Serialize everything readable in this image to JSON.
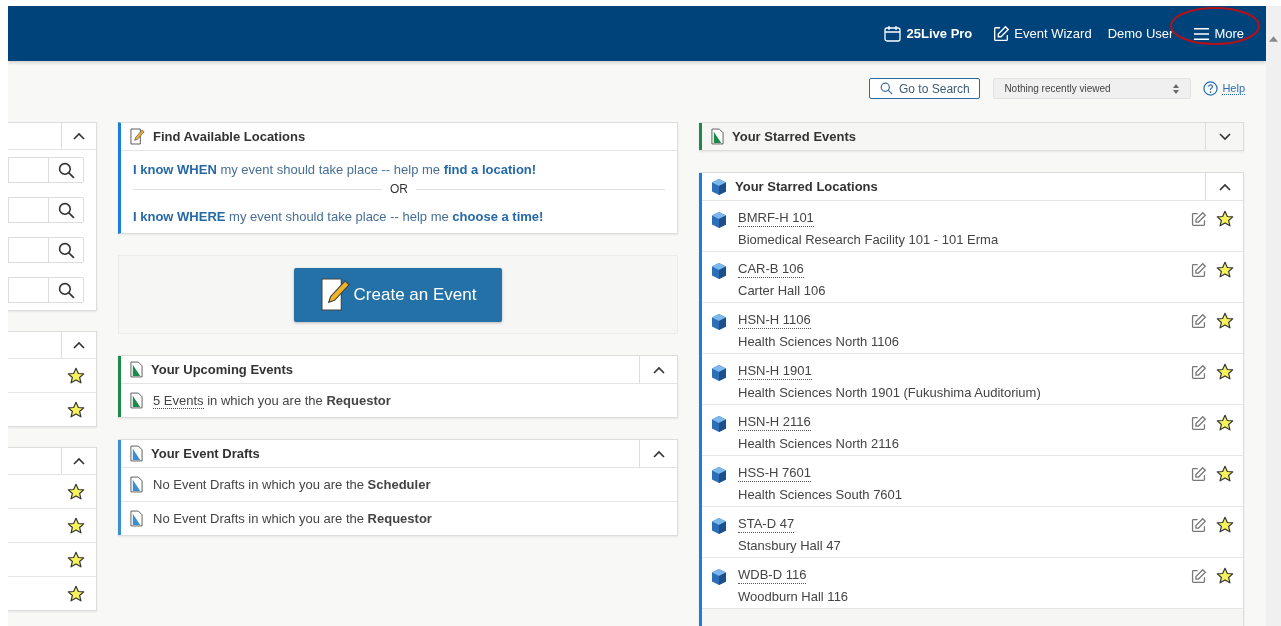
{
  "header": {
    "brand": "25Live Pro",
    "wizard": "Event Wizard",
    "user": "Demo User",
    "more": "More",
    "more_highlighted": true
  },
  "toolbar": {
    "search_button": "Go to Search",
    "recent": "Nothing recently viewed",
    "help": "Help"
  },
  "left_panels": [
    {
      "expanded": true,
      "rows": [
        {
          "kind": "search"
        },
        {
          "kind": "search"
        },
        {
          "kind": "search"
        },
        {
          "kind": "search"
        }
      ]
    },
    {
      "expanded": true,
      "rows": [
        {
          "kind": "star",
          "starred": true
        },
        {
          "kind": "star",
          "starred": true
        }
      ]
    },
    {
      "expanded": true,
      "rows": [
        {
          "kind": "star",
          "starred": true
        },
        {
          "kind": "star",
          "starred": true
        },
        {
          "kind": "star",
          "starred": true
        },
        {
          "kind": "star",
          "starred": true
        }
      ]
    }
  ],
  "finder": {
    "title": "Find Available Locations",
    "when": "**I know WHEN** my event should take place -- help me **find a location!**",
    "or": "OR",
    "where": "**I know WHERE** my event should take place -- help me **choose a time!**"
  },
  "create_button": "Create an Event",
  "event_panels": [
    {
      "title": "Your Upcoming Events",
      "color": "#1b8a4a",
      "expanded": true,
      "rows": [
        {
          "link": "5 Events",
          "text": " in which you are the **Requestor**"
        }
      ]
    },
    {
      "title": "Your Event Drafts",
      "color": "#3b8fd0",
      "expanded": true,
      "rows": [
        {
          "text": "No Event Drafts in which you are the **Scheduler**"
        },
        {
          "text": "No Event Drafts in which you are the **Requestor**"
        }
      ]
    }
  ],
  "starred_events": {
    "title": "Your Starred Events",
    "color": "#1b8a4a",
    "expanded": false
  },
  "starred_locations": {
    "title": "Your Starred Locations",
    "color": "#1a7ee0",
    "expanded": true,
    "items": [
      {
        "code": "BMRF-H 101",
        "name": "Biomedical Research Facility 101 - 101 Erma",
        "starred": true
      },
      {
        "code": "CAR-B 106",
        "name": "Carter Hall 106",
        "starred": true
      },
      {
        "code": "HSN-H 1106",
        "name": "Health Sciences North 1106",
        "starred": true
      },
      {
        "code": "HSN-H 1901",
        "name": "Health Sciences North 1901 (Fukushima Auditorium)",
        "starred": true
      },
      {
        "code": "HSN-H 2116",
        "name": "Health Sciences North 2116",
        "starred": true
      },
      {
        "code": "HSS-H 7601",
        "name": "Health Sciences South 7601",
        "starred": true
      },
      {
        "code": "STA-D 47",
        "name": "Stansbury Hall 47",
        "starred": true
      },
      {
        "code": "WDB-D 116",
        "name": "Woodburn Hall 116",
        "starred": true
      }
    ]
  }
}
